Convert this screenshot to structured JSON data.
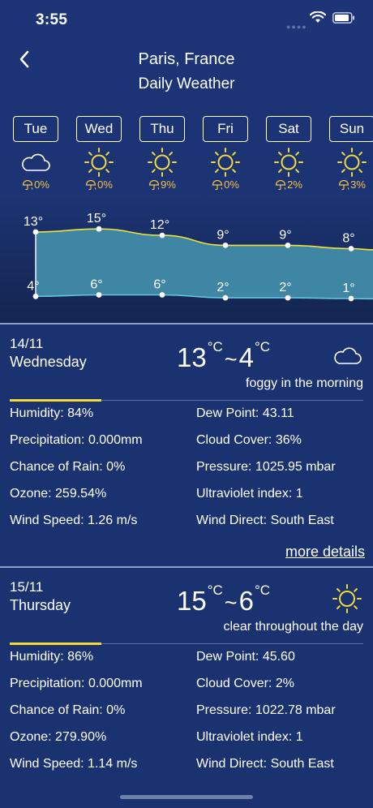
{
  "status_bar": {
    "time": "3:55"
  },
  "header": {
    "city": "Paris, France",
    "subtitle": "Daily Weather"
  },
  "days": [
    {
      "label": "Tue",
      "icon": "cloud-icon",
      "rain": "0%"
    },
    {
      "label": "Wed",
      "icon": "sun-icon",
      "rain": "0%"
    },
    {
      "label": "Thu",
      "icon": "sun-icon",
      "rain": "9%"
    },
    {
      "label": "Fri",
      "icon": "sun-icon",
      "rain": "0%"
    },
    {
      "label": "Sat",
      "icon": "sun-icon",
      "rain": "2%"
    },
    {
      "label": "Sun",
      "icon": "sun-icon",
      "rain": "3%"
    }
  ],
  "chart_data": {
    "type": "area",
    "categories": [
      "Tue",
      "Wed",
      "Thu",
      "Fri",
      "Sat",
      "Sun"
    ],
    "series": [
      {
        "values": [
          13,
          15,
          12,
          9,
          9,
          8
        ]
      },
      {
        "values": [
          4,
          6,
          6,
          2,
          2,
          1
        ]
      }
    ],
    "high_labels": [
      "13°",
      "15°",
      "12°",
      "9°",
      "9°",
      "8°"
    ],
    "low_labels": [
      "4°",
      "6°",
      "6°",
      "2°",
      "2°",
      "1°"
    ]
  },
  "cards": [
    {
      "date": "14/11",
      "weekday": "Wednesday",
      "high": "13",
      "low": "4",
      "unit": "°C",
      "tilde": "~",
      "icon": "cloud-icon",
      "summary": "foggy in the morning",
      "humidity": "Humidity: 84%",
      "precipitation": "Precipitation: 0.000mm",
      "chance_of_rain": "Chance of Rain: 0%",
      "ozone": "Ozone: 259.54%",
      "wind_speed": "Wind Speed: 1.26 m/s",
      "dew_point": "Dew Point: 43.11",
      "cloud_cover": "Cloud Cover: 36%",
      "pressure": "Pressure: 1025.95 mbar",
      "uv_index": "Ultraviolet index: 1",
      "wind_direction": "Wind Direct: South East",
      "more_label": "more details"
    },
    {
      "date": "15/11",
      "weekday": "Thursday",
      "high": "15",
      "low": "6",
      "unit": "°C",
      "tilde": "~",
      "icon": "sun-icon",
      "summary": "clear throughout the day",
      "humidity": "Humidity: 86%",
      "precipitation": "Precipitation: 0.000mm",
      "chance_of_rain": "Chance of Rain: 0%",
      "ozone": "Ozone: 279.90%",
      "wind_speed": "Wind Speed: 1.14 m/s",
      "dew_point": "Dew Point: 45.60",
      "cloud_cover": "Cloud Cover: 2%",
      "pressure": "Pressure: 1022.78 mbar",
      "uv_index": "Ultraviolet index: 1",
      "wind_direction": "Wind Direct: South East"
    }
  ],
  "colors": {
    "background": "#1b3271",
    "accent": "#f2d93c",
    "area_fill": "#3f86a4",
    "high_line": "#f2e23c",
    "low_line": "#63c4e0",
    "rain_text": "#f3c048"
  }
}
